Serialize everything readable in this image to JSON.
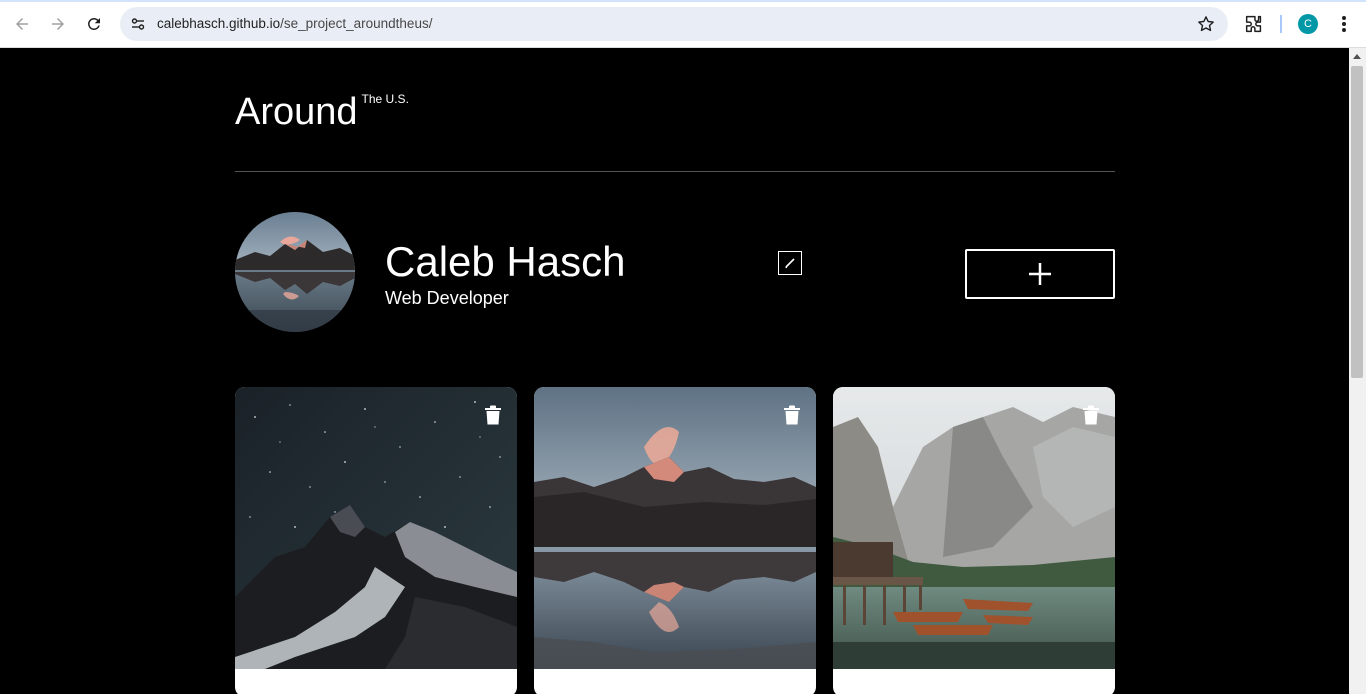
{
  "browser": {
    "url_host": "calebhasch.github.io",
    "url_path": "/se_project_aroundtheus/",
    "profile_initial": "C"
  },
  "header": {
    "logo_main": "Around",
    "logo_sup": "The U.S."
  },
  "profile": {
    "name": "Caleb Hasch",
    "job": "Web Developer"
  },
  "cards": [
    {
      "image": "starry-night-mountain",
      "title": ""
    },
    {
      "image": "mountain-lake-reflection",
      "title": ""
    },
    {
      "image": "alpine-lake-boats",
      "title": ""
    }
  ],
  "colors": {
    "page_bg": "#000000",
    "text": "#ffffff",
    "divider": "#545454",
    "omnibox_bg": "#e9eef6",
    "avatar_chip": "#0097a7"
  },
  "icons": [
    "back-icon",
    "forward-icon",
    "reload-icon",
    "site-info-icon",
    "bookmark-star-icon",
    "extensions-icon",
    "more-menu-icon",
    "edit-pencil-icon",
    "plus-icon",
    "trash-icon"
  ]
}
